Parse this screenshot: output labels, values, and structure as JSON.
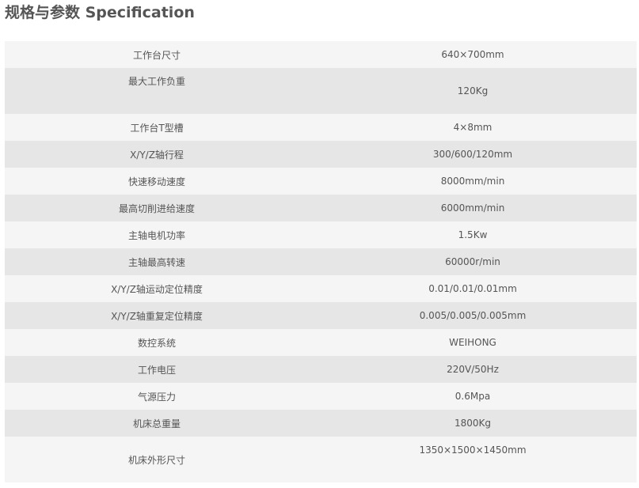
{
  "title": "规格与参数 Specification",
  "rows": [
    {
      "label": "工作台尺寸",
      "value": "640×700mm"
    },
    {
      "label": "最大工作负重",
      "value": "120Kg"
    },
    {
      "label": "工作台T型槽",
      "value": "4×8mm"
    },
    {
      "label": "X/Y/Z轴行程",
      "value": "300/600/120mm"
    },
    {
      "label": "快速移动速度",
      "value": "8000mm/min"
    },
    {
      "label": "最高切削进给速度",
      "value": "6000mm/min"
    },
    {
      "label": "主轴电机功率",
      "value": "1.5Kw"
    },
    {
      "label": "主轴最高转速",
      "value": "60000r/min"
    },
    {
      "label": "X/Y/Z轴运动定位精度",
      "value": "0.01/0.01/0.01mm"
    },
    {
      "label": "X/Y/Z轴重复定位精度",
      "value": "0.005/0.005/0.005mm"
    },
    {
      "label": "数控系统",
      "value": "WEIHONG"
    },
    {
      "label": "工作电压",
      "value": "220V/50Hz"
    },
    {
      "label": "气源压力",
      "value": "0.6Mpa"
    },
    {
      "label": "机床总重量",
      "value": "1800Kg"
    },
    {
      "label": "机床外形尺寸",
      "value": "1350×1500×1450mm"
    }
  ]
}
